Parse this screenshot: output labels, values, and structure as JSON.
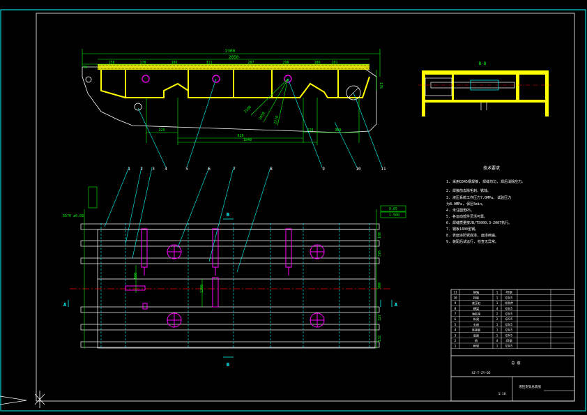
{
  "colors": {
    "background": "#000000",
    "frame": "#ffffff",
    "outer_frame": "#00ffff",
    "steel": "#ffff00",
    "dimension": "#00ff00",
    "leader": "#00ffff",
    "center": "#ff0000",
    "cylinder": "#ff00ff",
    "outline": "#ffffff",
    "table_text": "#ffffff"
  },
  "elevation": {
    "dims_top": [
      "2300",
      "2050"
    ],
    "dims_segments": [
      "70",
      "158",
      "178",
      "186",
      "311",
      "287",
      "298",
      "186",
      "101"
    ],
    "dims_bottom": [
      "220",
      "620",
      "1848",
      "128",
      "368"
    ],
    "dims_angle": [
      "2100",
      "2050",
      "2270"
    ],
    "dim_height": "175"
  },
  "section": {
    "title": "B-B"
  },
  "plan": {
    "section_a": "A",
    "section_b": "B",
    "tolerance_left": "5570 ±0.03",
    "dim_vertical_1": "500",
    "dim_vertical_2": "1200",
    "dims_right": [
      "180",
      "376",
      "900",
      "327",
      "132"
    ],
    "gd_t_1": "0.05",
    "gd_t_2": "1.500"
  },
  "balloons": [
    "1",
    "2",
    "3",
    "4",
    "5",
    "6",
    "7",
    "8",
    "9",
    "10",
    "11"
  ],
  "notes": {
    "title": "技术要求",
    "items": [
      "1. 采用Q345钢焊接, 焊缝均匀, 焊后消除应力。",
      "2. 焊接前去除毛刺、锈蚀。",
      "3. 液压系统工作压力7.0MPa, 试验压力",
      "   为8.0MPa, 保压5min。",
      "4. 未注圆角R5。",
      "5. 各运动部件灵活可靠。",
      "6. 焊缝质量按JB/T5000.3-2007执行。",
      "7. 钢板1400型钢。",
      "8. 表面涂防锈底漆, 面漆两遍。",
      "9. 装配后试运行, 检查无异常。"
    ]
  },
  "bom": {
    "rows": [
      [
        "11",
        "销轴",
        "1",
        "45钢"
      ],
      [
        "10",
        "挡板",
        "1",
        "Q345"
      ],
      [
        "9",
        "液压缸",
        "1",
        "外购件"
      ],
      [
        "8",
        "横梁",
        "4",
        "Q345"
      ],
      [
        "7",
        "油缸座",
        "2",
        "Q345"
      ],
      [
        "6",
        "纵梁",
        "2",
        "Q235"
      ],
      [
        "5",
        "支座",
        "1",
        "Q345"
      ],
      [
        "4",
        "连接板",
        "1",
        "Q345"
      ],
      [
        "3",
        "底座",
        "1",
        "Q345"
      ],
      [
        "2",
        "销",
        "4",
        "45钢"
      ],
      [
        "1",
        "框架",
        "1",
        "Q345"
      ]
    ],
    "title_left": "XZ-T-ZY-05",
    "title_mid": "总 装",
    "title_right": "液压支架总装图",
    "scale": "1:10"
  }
}
